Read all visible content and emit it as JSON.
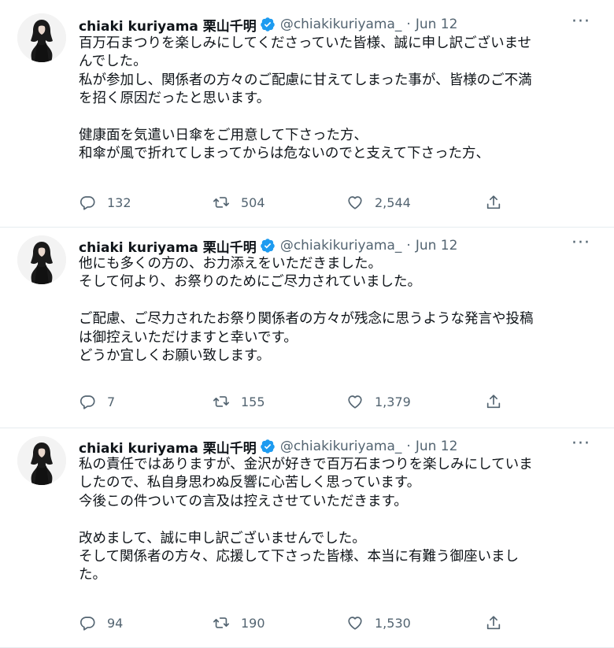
{
  "tweets": [
    {
      "author": {
        "name": "chiaki kuriyama 栗山千明",
        "handle": "@chiakikuriyama_",
        "verified": true
      },
      "separator": "·",
      "date": "Jun 12",
      "lines": [
        "百万石まつりを楽しみにしてくださっていた皆様、誠に申し訳ございませ",
        "んでした。",
        "私が参加し、関係者の方々のご配慮に甘えてしまった事が、皆様のご不満",
        "を招く原因だったと思います。",
        "",
        "健康面を気遣い日傘をご用意して下さった方、",
        "和傘が風で折れてしまってからは危ないのでと支えて下さった方、"
      ],
      "stats": {
        "replies": "132",
        "retweets": "504",
        "likes": "2,544"
      }
    },
    {
      "author": {
        "name": "chiaki kuriyama 栗山千明",
        "handle": "@chiakikuriyama_",
        "verified": true
      },
      "separator": "·",
      "date": "Jun 12",
      "lines": [
        "他にも多くの方の、お力添えをいただきました。",
        "そして何より、お祭りのためにご尽力されていました。",
        "",
        "ご配慮、ご尽力されたお祭り関係者の方々が残念に思うような発言や投稿",
        "は御控えいただけますと幸いです。",
        "どうか宜しくお願い致します。"
      ],
      "stats": {
        "replies": "7",
        "retweets": "155",
        "likes": "1,379"
      }
    },
    {
      "author": {
        "name": "chiaki kuriyama 栗山千明",
        "handle": "@chiakikuriyama_",
        "verified": true
      },
      "separator": "·",
      "date": "Jun 12",
      "lines": [
        "私の責任ではありますが、金沢が好きで百万石まつりを楽しみにしていま",
        "したので、私自身思わぬ反響に心苦しく思っています。",
        "今後この件ついての言及は控えさせていただきます。",
        "",
        "改めまして、誠に申し訳ございませんでした。",
        "そして関係者の方々、応援して下さった皆様、本当に有難う御座いまし",
        "た。"
      ],
      "stats": {
        "replies": "94",
        "retweets": "190",
        "likes": "1,530"
      }
    }
  ],
  "icons": {
    "verified": "verified-badge-icon",
    "more": "more-options-icon",
    "reply": "reply-icon",
    "retweet": "retweet-icon",
    "like": "heart-icon",
    "share": "share-icon"
  },
  "colors": {
    "verified": "#1d9bf0",
    "secondary_text": "#536471",
    "divider": "#e6ecf0"
  }
}
